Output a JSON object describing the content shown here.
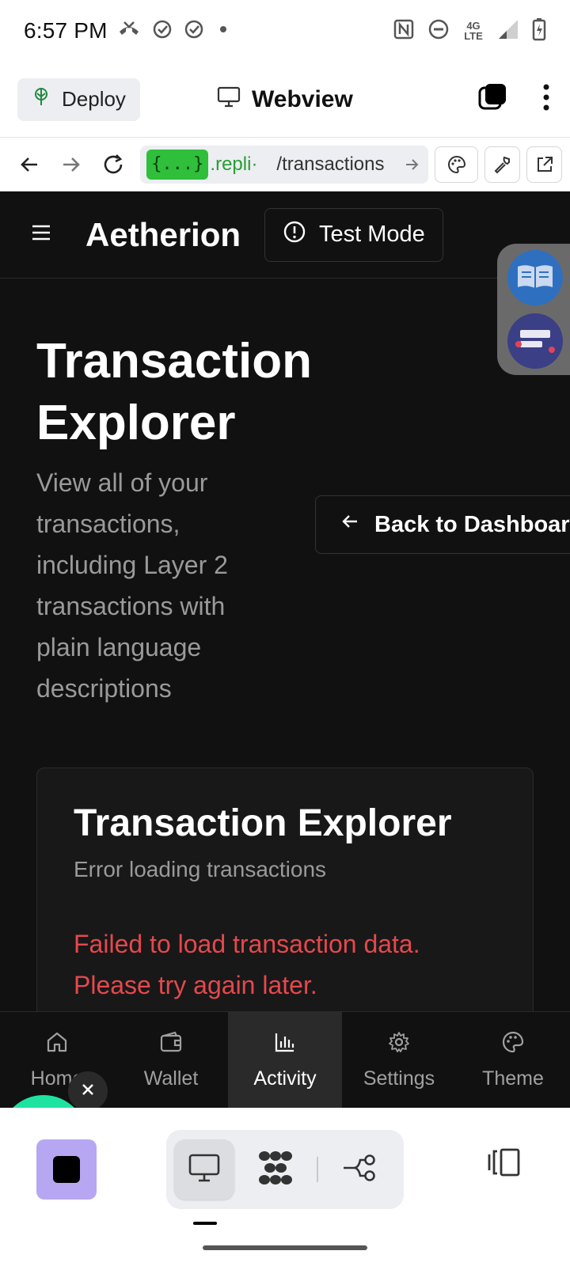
{
  "status_bar": {
    "time": "6:57 PM",
    "network_label": "4G LTE",
    "icons": [
      "missed-call-icon",
      "check-circle-icon",
      "check-circle-icon",
      "dot-icon",
      "nfc-icon",
      "do-not-disturb-icon",
      "signal-icon",
      "battery-charging-icon"
    ]
  },
  "replit_header": {
    "deploy_label": "Deploy",
    "title": "Webview"
  },
  "url_bar": {
    "tag": "{...}",
    "host": ".repli·",
    "path": "/transactions"
  },
  "app": {
    "brand": "Aetherion",
    "test_mode_label": "Test Mode",
    "page_title": "Transaction Explorer",
    "page_description": "View all of your transactions, including Layer 2 transactions with plain language descriptions",
    "back_button_label": "Back to Dashboard",
    "card": {
      "title": "Transaction Explorer",
      "subtitle": "Error loading transactions",
      "error_message": "Failed to load transaction data. Please try again later."
    },
    "tabs": [
      {
        "label": "Home",
        "icon": "home-icon",
        "active": false
      },
      {
        "label": "Wallet",
        "icon": "wallet-icon",
        "active": false
      },
      {
        "label": "Activity",
        "icon": "bar-chart-icon",
        "active": true
      },
      {
        "label": "Settings",
        "icon": "gear-icon",
        "active": false
      },
      {
        "label": "Theme",
        "icon": "palette-icon",
        "active": false
      }
    ]
  },
  "colors": {
    "app_background": "#111111",
    "error_red": "#e5484d",
    "url_tag_green": "#2fbf3a",
    "stop_button_purple": "#b7a7f3",
    "toast_green": "#1ee3a0"
  }
}
